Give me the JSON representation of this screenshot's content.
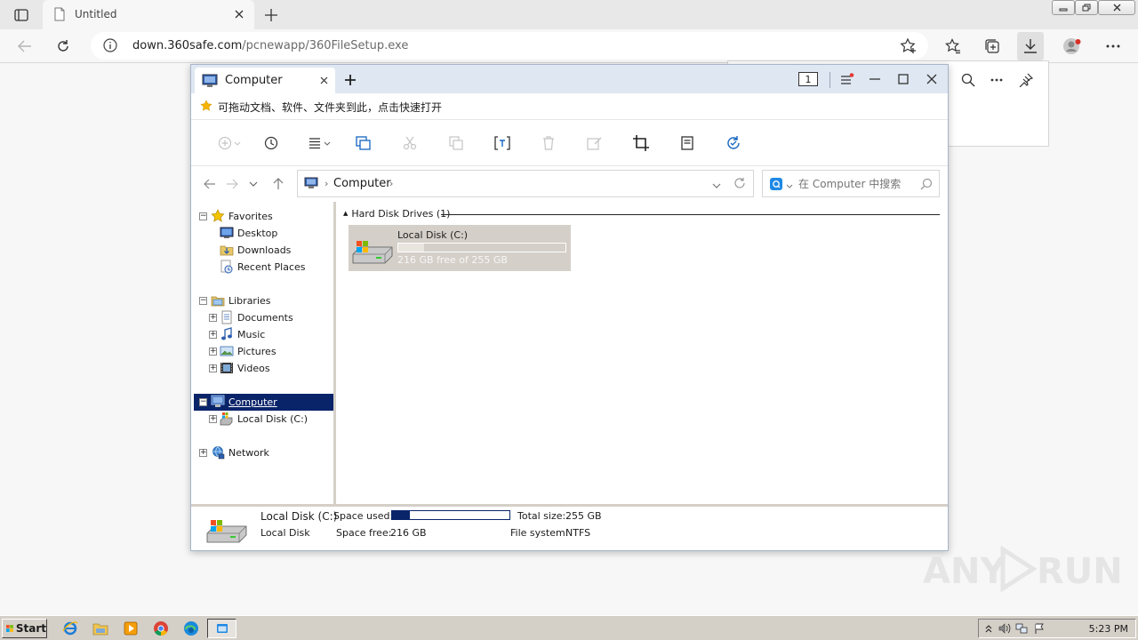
{
  "browser": {
    "tab_title": "Untitled",
    "url_host": "down.360safe.com",
    "url_path": "/pcnewapp/360FileSetup.exe"
  },
  "explorer": {
    "tab_title": "Computer",
    "window_count": "1",
    "favbar_text": "可拖动文档、软件、文件夹到此，点击快速打开",
    "breadcrumb": "Computer",
    "search_placeholder": "在 Computer 中搜索",
    "nav": {
      "favorites": "Favorites",
      "desktop": "Desktop",
      "downloads": "Downloads",
      "recent_places": "Recent Places",
      "libraries": "Libraries",
      "documents": "Documents",
      "music": "Music",
      "pictures": "Pictures",
      "videos": "Videos",
      "computer": "Computer",
      "local_disk": "Local Disk (C:)",
      "network": "Network"
    },
    "group_header": "Hard Disk Drives (1)",
    "drive": {
      "name": "Local Disk (C:)",
      "free_text": "216 GB free of 255 GB",
      "used_fraction": 0.153
    },
    "details": {
      "name": "Local Disk (C:)",
      "type": "Local Disk",
      "space_used_label": "Space used:",
      "space_free_label": "Space free:",
      "space_free_value": "216 GB",
      "total_size_label": "Total size:",
      "total_size_value": "255 GB",
      "file_system_label": "File system:",
      "file_system_value": "NTFS"
    }
  },
  "taskbar": {
    "start_label": "Start",
    "clock": "5:23 PM"
  },
  "watermark": {
    "left": "ANY",
    "right": "RUN"
  },
  "colors": {
    "selection": "#0a246a",
    "explorer_titlebar": "#dfe7f2",
    "taskbar": "#d4d0c8"
  }
}
